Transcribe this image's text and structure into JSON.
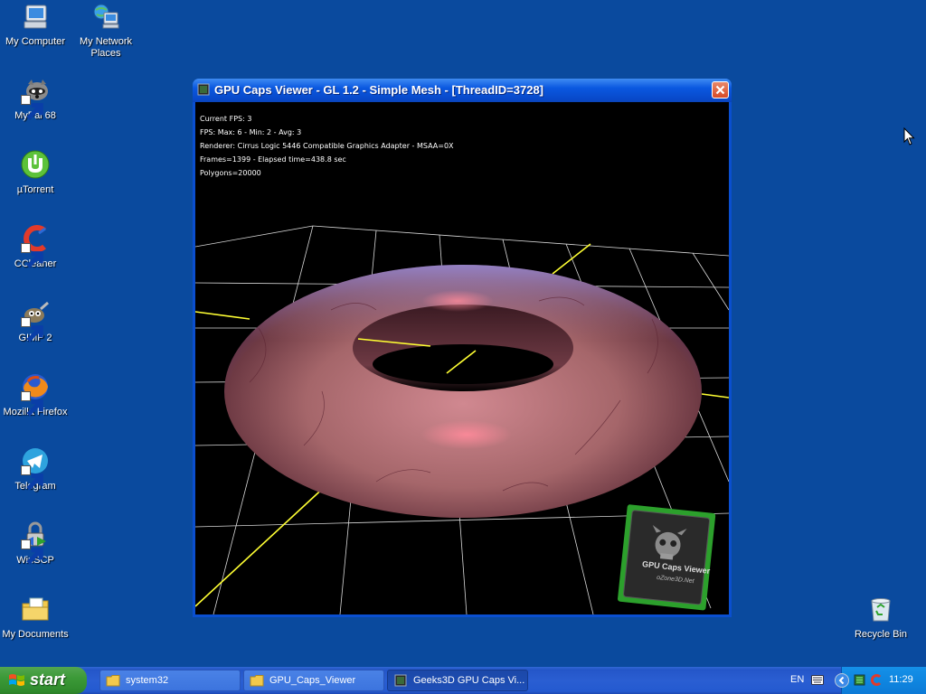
{
  "desktop": {
    "icons": [
      {
        "label": "My Computer",
        "icon": "my-computer-icon"
      },
      {
        "label": "My Network Places",
        "icon": "network-places-icon"
      },
      {
        "label": "MyPal 68",
        "icon": "mypal-icon"
      },
      {
        "label": "µTorrent",
        "icon": "utorrent-icon"
      },
      {
        "label": "CCleaner",
        "icon": "ccleaner-icon"
      },
      {
        "label": "GIMP 2",
        "icon": "gimp-icon"
      },
      {
        "label": "Mozilla Firefox",
        "icon": "firefox-icon"
      },
      {
        "label": "Telegram",
        "icon": "telegram-icon"
      },
      {
        "label": "WinSCP",
        "icon": "winscp-icon"
      },
      {
        "label": "My Documents",
        "icon": "my-documents-icon"
      },
      {
        "label": "Recycle Bin",
        "icon": "recycle-bin-icon"
      }
    ]
  },
  "window": {
    "title": "GPU Caps Viewer - GL 1.2 - Simple Mesh - [ThreadID=3728]",
    "hud": {
      "fps": "Current FPS: 3",
      "fps_stats": "FPS: Max: 6 - Min: 2 - Avg: 3",
      "renderer": "Renderer: Cirrus Logic 5446 Compatible Graphics Adapter - MSAA=0X",
      "frames": "Frames=1399 - Elapsed time=438.8 sec",
      "polygons": "Polygons=20000"
    },
    "logo": {
      "title": "GPU Caps Viewer",
      "site": "oZone3D.Net"
    },
    "colors": {
      "grid": "#ffffff",
      "axis": "#ffff33",
      "torus": "#b06a6c",
      "logo_border": "#2ca02c"
    }
  },
  "taskbar": {
    "start_label": "start",
    "tasks": [
      {
        "label": "system32",
        "icon": "folder-icon"
      },
      {
        "label": "GPU_Caps_Viewer",
        "icon": "folder-icon"
      },
      {
        "label": "Geeks3D GPU Caps Vi...",
        "icon": "gpu-app-icon"
      }
    ],
    "language": "EN",
    "clock": "11:29"
  }
}
